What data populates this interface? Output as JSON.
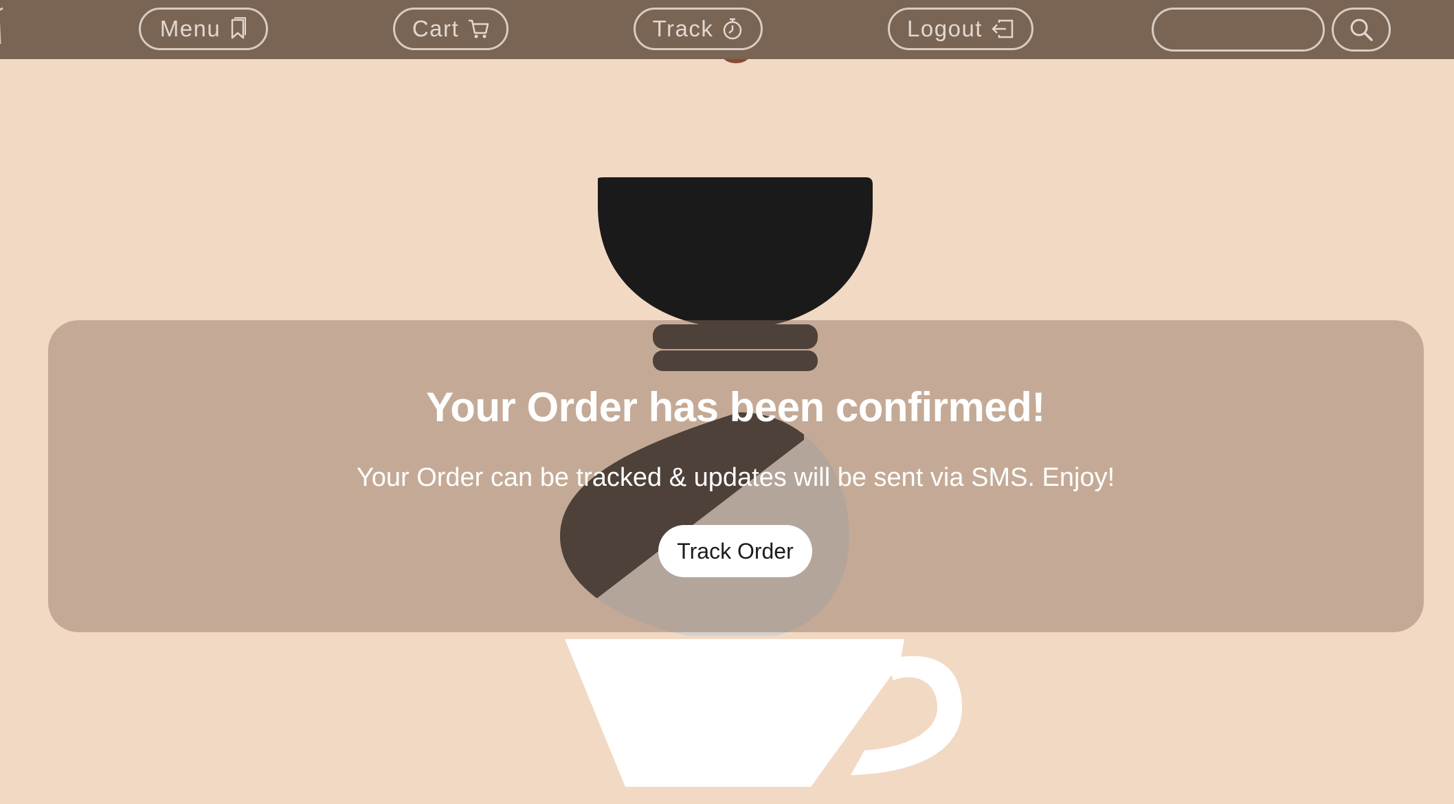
{
  "nav": {
    "menu_label": "Menu",
    "cart_label": "Cart",
    "track_label": "Track",
    "logout_label": "Logout",
    "search_value": ""
  },
  "confirmation": {
    "title": "Your Order has been confirmed!",
    "message": "Your Order can be tracked & updates will be sent via SMS. Enjoy!",
    "track_button_label": "Track Order"
  },
  "icons": {
    "menu": "bookmark-icon",
    "cart": "cart-icon",
    "track": "stopwatch-icon",
    "logout": "logout-icon",
    "search": "search-icon"
  },
  "colors": {
    "nav_background": "#7a6454",
    "page_background": "#f2d9c3",
    "card_background": "#b9a291",
    "brewer_dark": "#1a1a1a",
    "brewer_light": "#d6d0cc",
    "cup": "#ffffff",
    "button_background": "#ffffff"
  }
}
